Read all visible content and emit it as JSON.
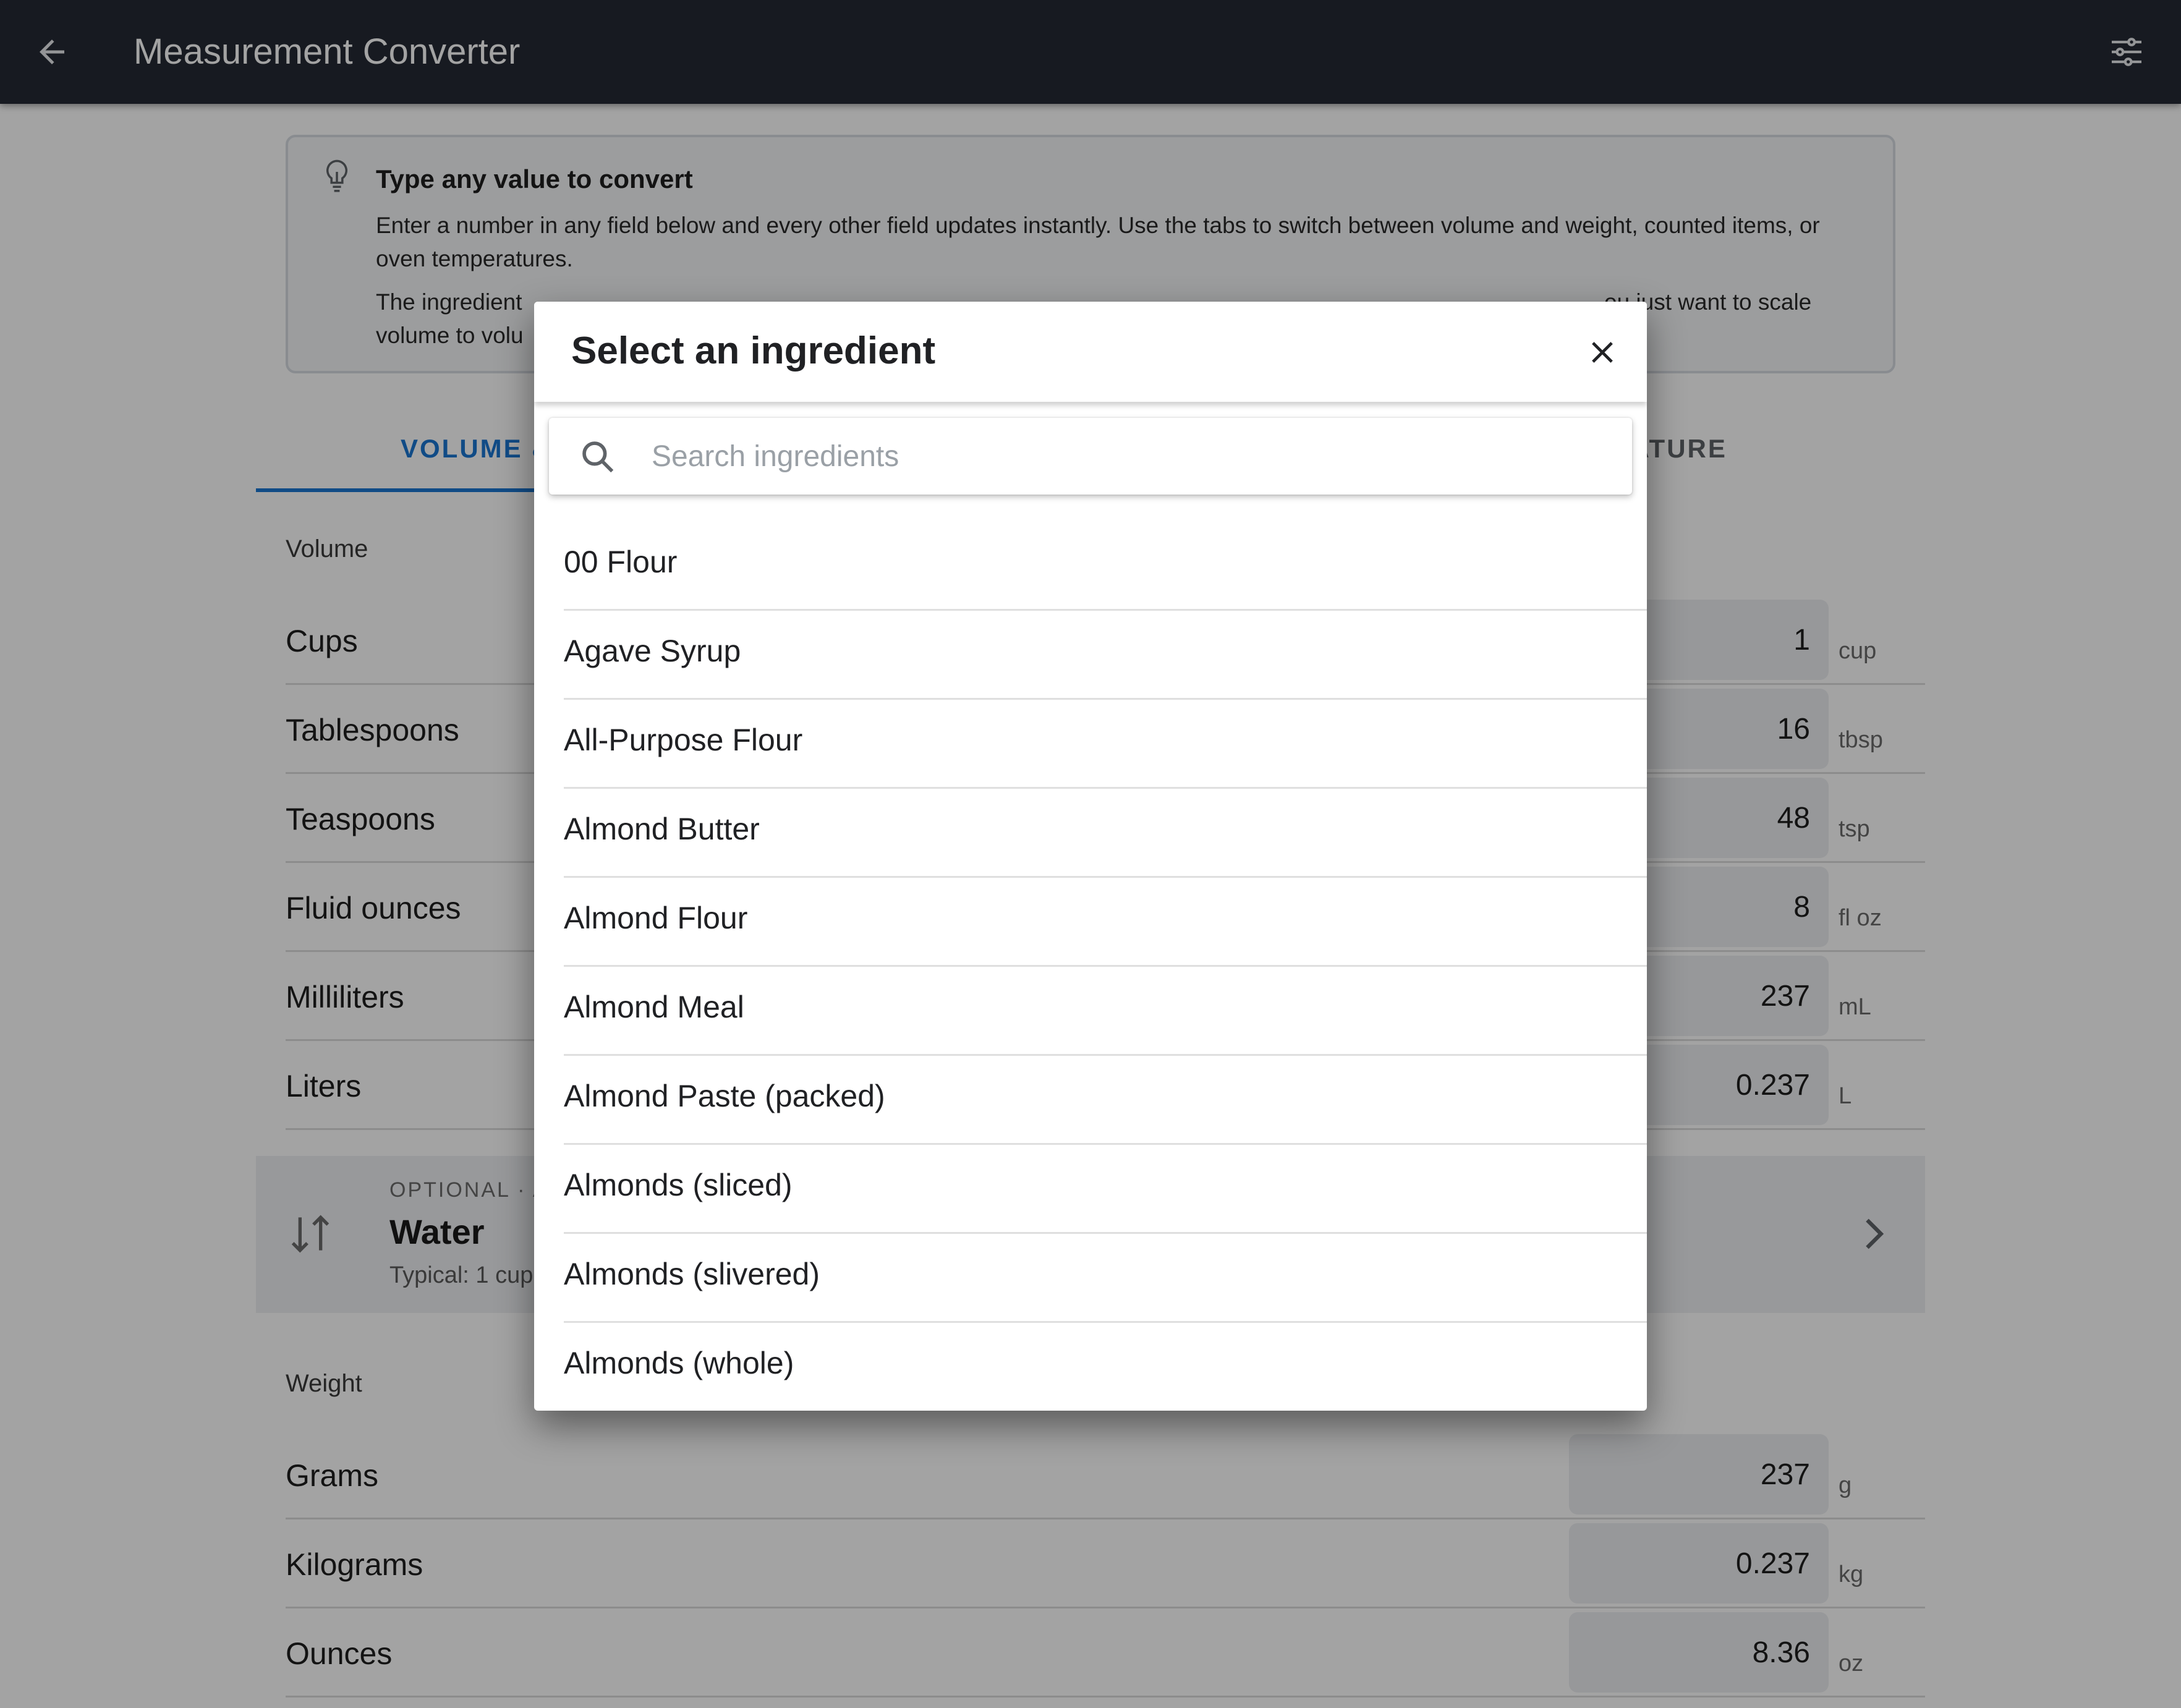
{
  "appbar": {
    "title": "Measurement Converter",
    "back_icon": "arrow-left-icon",
    "settings_icon": "tune-sliders-icon"
  },
  "info": {
    "heading": "Type any value to convert",
    "paragraph1": "Enter a number in any field below and every other field updates instantly. Use the tabs to switch between volume and weight, counted items, or oven temperatures.",
    "paragraph2_visible_start": "The ingredient",
    "paragraph2_visible_end": "ou just want to scale",
    "paragraph2_line2_start": "volume to volu",
    "icon": "lightbulb-icon"
  },
  "tabs": {
    "active": "VOLUME &",
    "partial_right": "RATURE"
  },
  "volume": {
    "label": "Volume",
    "rows": [
      {
        "name": "Cups",
        "value": "1",
        "unit": "cup"
      },
      {
        "name": "Tablespoons",
        "value": "16",
        "unit": "tbsp"
      },
      {
        "name": "Teaspoons",
        "value": "48",
        "unit": "tsp"
      },
      {
        "name": "Fluid ounces",
        "value": "8",
        "unit": "fl oz"
      },
      {
        "name": "Milliliters",
        "value": "237",
        "unit": "mL"
      },
      {
        "name": "Liters",
        "value": "0.237",
        "unit": "L"
      }
    ]
  },
  "ingredient_bar": {
    "caption": "OPTIONAL · A",
    "name": "Water",
    "typical": "Typical: 1 cup"
  },
  "weight": {
    "label": "Weight",
    "rows": [
      {
        "name": "Grams",
        "value": "237",
        "unit": "g"
      },
      {
        "name": "Kilograms",
        "value": "0.237",
        "unit": "kg"
      },
      {
        "name": "Ounces",
        "value": "8.36",
        "unit": "oz"
      }
    ]
  },
  "dialog": {
    "title": "Select an ingredient",
    "close_icon": "close-icon",
    "search": {
      "placeholder": "Search ingredients",
      "value": "",
      "icon": "search-icon"
    },
    "items": [
      "00 Flour",
      "Agave Syrup",
      "All-Purpose Flour",
      "Almond Butter",
      "Almond Flour",
      "Almond Meal",
      "Almond Paste (packed)",
      "Almonds (sliced)",
      "Almonds (slivered)",
      "Almonds (whole)"
    ]
  },
  "colors": {
    "appbar": "#252a34",
    "accent": "#1976d2",
    "scrim": "rgba(0,0,0,0.36)"
  }
}
